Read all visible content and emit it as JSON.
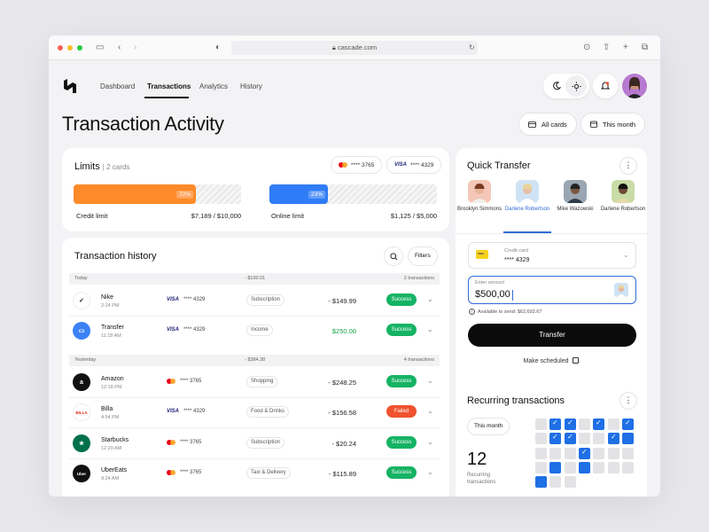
{
  "browser": {
    "url": "cascade.com"
  },
  "nav": {
    "dashboard": "Dashboard",
    "transactions": "Transactions",
    "analytics": "Analytics",
    "history": "History"
  },
  "page": {
    "title": "Transaction Activity",
    "all_cards": "All cards",
    "this_month": "This month"
  },
  "limits": {
    "title": "Limits",
    "cards_count": "| 2 cards",
    "card1": "**** 3765",
    "card2": "**** 4329",
    "credit": {
      "label": "Credit limit",
      "pct_label": "72%",
      "pct": 0.72,
      "amount": "$7,189 / $10,000",
      "color": "#ff8a2a"
    },
    "online": {
      "label": "Online limit",
      "pct_label": "23%",
      "pct": 0.23,
      "amount": "$1,125 / $5,000",
      "color": "#2f7cf6"
    }
  },
  "history": {
    "title": "Transaction history",
    "filters": "Filters",
    "groups": [
      {
        "day": "Today",
        "total": "- $100.01",
        "count": "2 transactions"
      },
      {
        "day": "Yesterday",
        "total": "- $384.38",
        "count": "4 transactions"
      }
    ],
    "rows": [
      {
        "name": "Nike",
        "time": "2:24 PM",
        "card_type": "VISA",
        "card": "**** 4329",
        "category": "Subscription",
        "amount": "- $149.99",
        "status": "Success",
        "logo": "✓",
        "logo_bg": "#ffffff",
        "logo_fg": "#111111"
      },
      {
        "name": "Transfer",
        "time": "11:18 AM",
        "card_type": "VISA",
        "card": "**** 4329",
        "category": "Income",
        "amount": "$250.00",
        "status": "Success",
        "logo": "▭",
        "logo_bg": "#3b82f6",
        "logo_fg": "#ffffff"
      },
      {
        "name": "Amazon",
        "time": "12:18 PM",
        "card_type": "MC",
        "card": "**** 3765",
        "category": "Shopping",
        "amount": "- $248.25",
        "status": "Success",
        "logo": "a",
        "logo_bg": "#111111",
        "logo_fg": "#ffffff"
      },
      {
        "name": "Billa",
        "time": "4:54 PM",
        "card_type": "VISA",
        "card": "**** 4329",
        "category": "Food & Drinks",
        "amount": "- $156.58",
        "status": "Failed",
        "logo": "BILLA",
        "logo_bg": "#ffffff",
        "logo_fg": "#e2231a"
      },
      {
        "name": "Starbucks",
        "time": "12:20 AM",
        "card_type": "MC",
        "card": "**** 3765",
        "category": "Subscription",
        "amount": "- $20.24",
        "status": "Success",
        "logo": "★",
        "logo_bg": "#00704a",
        "logo_fg": "#ffffff"
      },
      {
        "name": "UberEats",
        "time": "9:24 AM",
        "card_type": "MC",
        "card": "**** 3765",
        "category": "Taxi & Delivery",
        "amount": "- $115.89",
        "status": "Success",
        "logo": "Uber",
        "logo_bg": "#111111",
        "logo_fg": "#ffffff"
      }
    ],
    "colors": {
      "success": "#16b364",
      "failed": "#f0522d",
      "income": "#16a34a"
    }
  },
  "quick_transfer": {
    "title": "Quick Transfer",
    "contacts": [
      {
        "name": "Brooklyn Simmons",
        "bg": "#f4c7b8"
      },
      {
        "name": "Darlene Robertson",
        "bg": "#cfe3f4"
      },
      {
        "name": "Mike Wazowski",
        "bg": "#9aa6b1"
      },
      {
        "name": "Darlene Robertson",
        "bg": "#c9dca6"
      }
    ],
    "card_label": "Credit card",
    "card_number": "**** 4329",
    "amount_label": "Enter amount",
    "amount_value": "$500,00",
    "available": "Available to send: $62,693.67",
    "transfer": "Transfer",
    "schedule": "Make scheduled"
  },
  "recurring": {
    "title": "Recurring transactions",
    "period": "This month",
    "count": "12",
    "count_label": "Recurring transactions",
    "grid": [
      [
        "empty",
        "chk",
        "chk",
        "empty",
        "chk",
        "empty",
        "chk"
      ],
      [
        "empty",
        "chk",
        "chk",
        "empty",
        "empty",
        "chk",
        "on"
      ],
      [
        "empty",
        "empty",
        "empty",
        "chk",
        "empty",
        "empty",
        "empty"
      ],
      [
        "empty",
        "on",
        "empty",
        "on",
        "empty",
        "empty",
        "empty"
      ],
      [
        "on",
        "empty",
        "empty"
      ]
    ]
  }
}
